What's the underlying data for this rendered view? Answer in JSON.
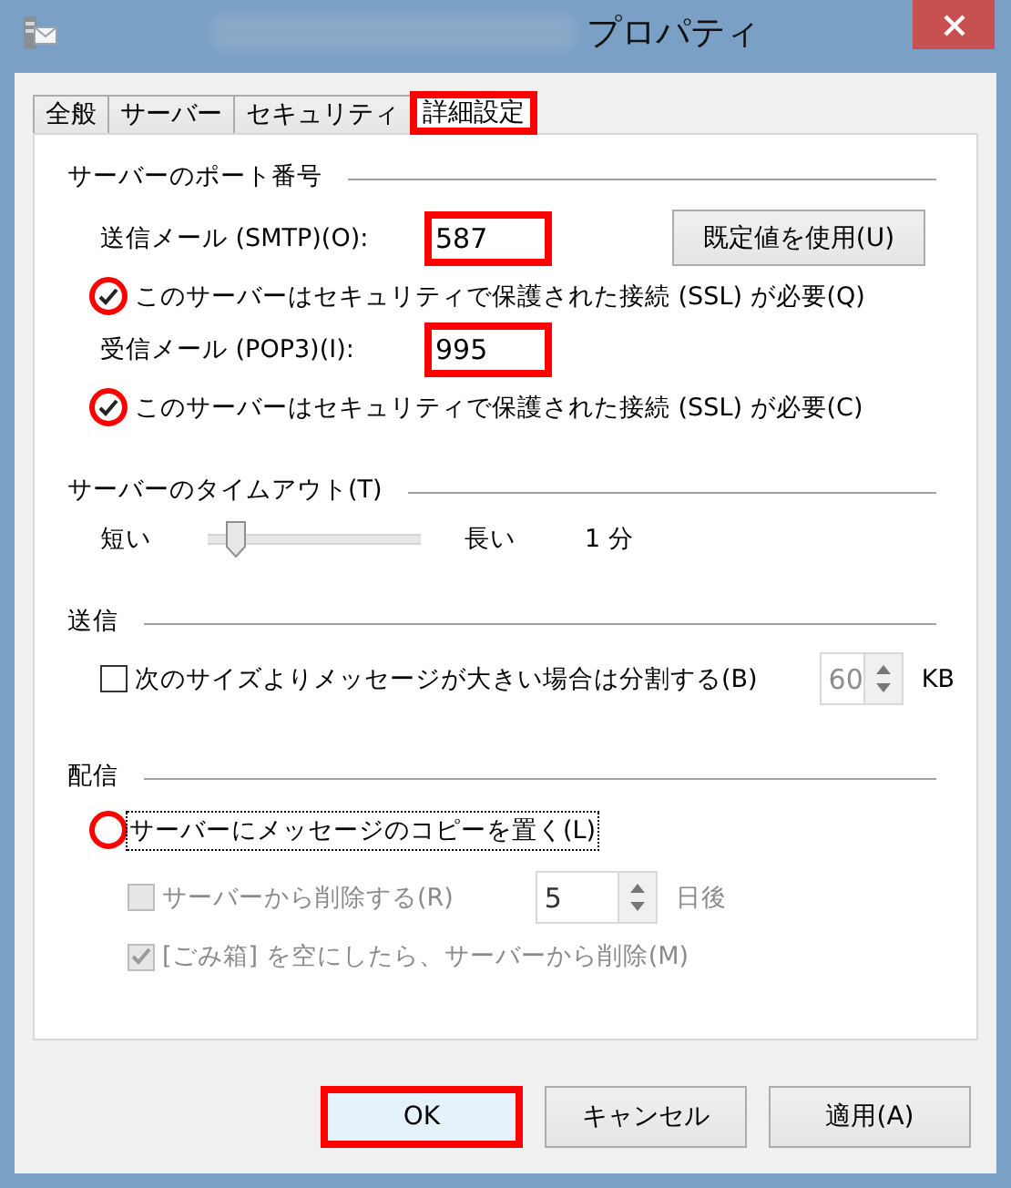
{
  "window": {
    "title": "プロパティ"
  },
  "tabs": [
    {
      "label": "全般",
      "selected": false,
      "highlighted": false
    },
    {
      "label": "サーバー",
      "selected": false,
      "highlighted": false
    },
    {
      "label": "セキュリティ",
      "selected": false,
      "highlighted": false
    },
    {
      "label": "詳細設定",
      "selected": true,
      "highlighted": true
    }
  ],
  "ports": {
    "title": "サーバーのポート番号",
    "outgoing": {
      "label": "送信メール (SMTP)(O):",
      "value": "587",
      "highlighted": true
    },
    "default_button": "既定値を使用(U)",
    "outgoing_ssl": {
      "label": "このサーバーはセキュリティで保護された接続 (SSL) が必要(Q)",
      "checked": true,
      "highlighted": true
    },
    "incoming": {
      "label": "受信メール (POP3)(I):",
      "value": "995",
      "highlighted": true
    },
    "incoming_ssl": {
      "label": "このサーバーはセキュリティで保護された接続 (SSL) が必要(C)",
      "checked": true,
      "highlighted": true
    }
  },
  "timeout": {
    "title": "サーバーのタイムアウト(T)",
    "min_label": "短い",
    "max_label": "長い",
    "level": 0.13,
    "reading": "1 分"
  },
  "sending": {
    "title": "送信",
    "split": {
      "label": "次のサイズよりメッセージが大きい場合は分割する(B)",
      "checked": false,
      "highlighted": false
    },
    "size": {
      "value": "60",
      "disabled": true
    },
    "unit": "KB"
  },
  "delivery": {
    "title": "配信",
    "leave_copy": {
      "label": "サーバーにメッセージのコピーを置く(L)",
      "checked": false,
      "highlighted": true,
      "focused": true
    },
    "remove": {
      "label": "サーバーから削除する(R)",
      "checked": false,
      "disabled": true
    },
    "days": {
      "value": "5",
      "disabled": true
    },
    "days_unit": "日後",
    "remove_on_empty": {
      "label": "[ごみ箱] を空にしたら、サーバーから削除(M)",
      "checked": true,
      "disabled": true
    }
  },
  "buttons": [
    {
      "label": "OK",
      "default": true,
      "highlighted": true
    },
    {
      "label": "キャンセル",
      "default": false,
      "highlighted": false
    },
    {
      "label": "適用(A)",
      "default": false,
      "highlighted": false
    }
  ]
}
